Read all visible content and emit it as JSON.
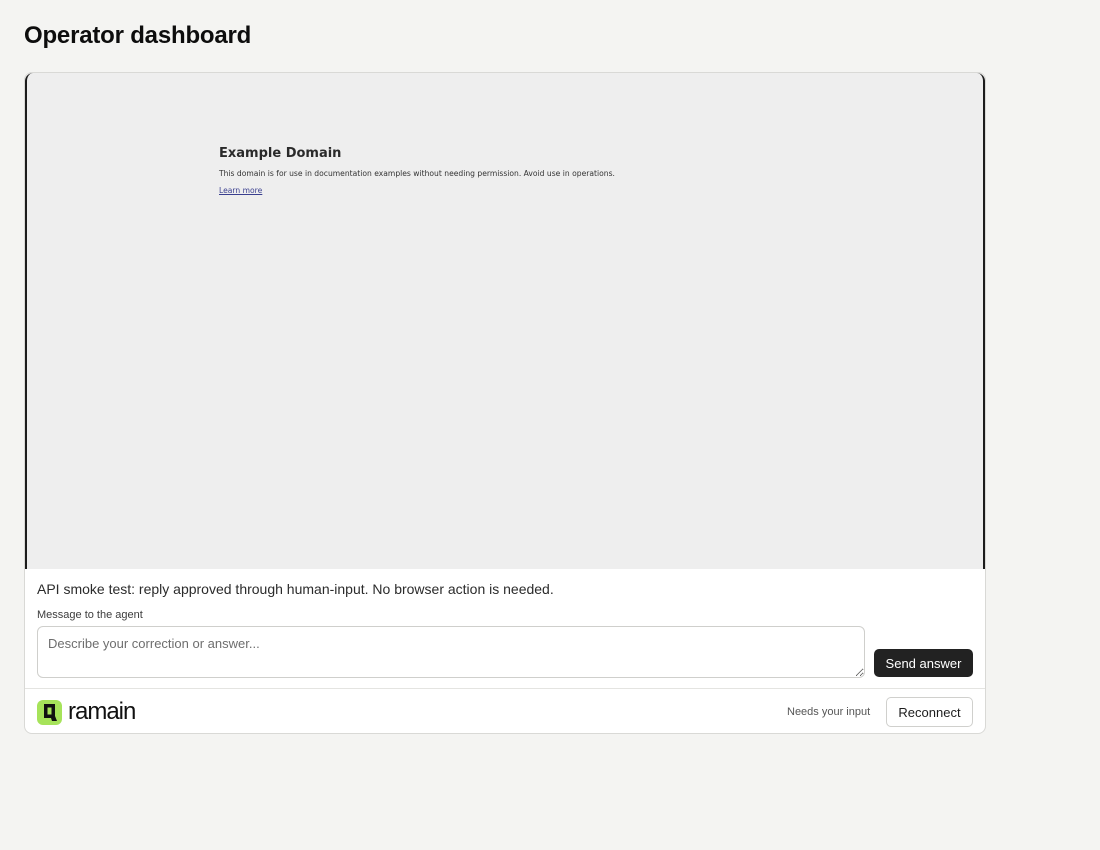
{
  "page": {
    "title": "Operator dashboard"
  },
  "viewport": {
    "heading": "Example Domain",
    "text": "This domain is for use in documentation examples without needing permission. Avoid use in operations.",
    "link": "Learn more"
  },
  "agent_message": "API smoke test: reply approved through human-input. No browser action is needed.",
  "reply": {
    "label": "Message to the agent",
    "placeholder": "Describe your correction or answer...",
    "value": "",
    "send_label": "Send answer"
  },
  "footer": {
    "brand": "ramain",
    "logo_icon": "ramain-logo-icon",
    "logo_color": "#a6e35a",
    "status": "Needs your input",
    "reconnect_label": "Reconnect"
  }
}
